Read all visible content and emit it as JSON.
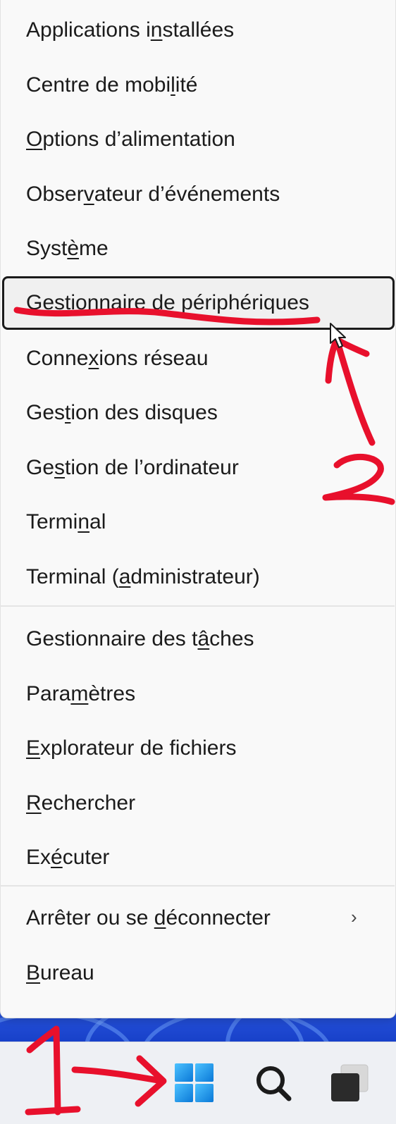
{
  "menu": {
    "group1": [
      {
        "before": "Applications i",
        "u": "n",
        "after": "stallées"
      },
      {
        "before": "Centre de mobi",
        "u": "l",
        "after": "ité"
      },
      {
        "before": "",
        "u": "O",
        "after": "ptions d’alimentation"
      },
      {
        "before": "Obser",
        "u": "v",
        "after": "ateur d’événements"
      },
      {
        "before": "Syst",
        "u": "è",
        "after": "me"
      },
      {
        "before": "",
        "u": "G",
        "after": "estionnaire de périphériques"
      },
      {
        "before": "Conne",
        "u": "x",
        "after": "ions réseau"
      },
      {
        "before": "Ges",
        "u": "t",
        "after": "ion des disques"
      },
      {
        "before": "Ge",
        "u": "s",
        "after": "tion de l’ordinateur"
      },
      {
        "before": "Termi",
        "u": "n",
        "after": "al"
      },
      {
        "before": "Terminal (",
        "u": "a",
        "after": "dministrateur)"
      }
    ],
    "group2": [
      {
        "before": "Gestionnaire des t",
        "u": "â",
        "after": "ches"
      },
      {
        "before": "Para",
        "u": "m",
        "after": "ètres"
      },
      {
        "before": "",
        "u": "E",
        "after": "xplorateur de fichiers"
      },
      {
        "before": "",
        "u": "R",
        "after": "echercher"
      },
      {
        "before": "Ex",
        "u": "é",
        "after": "cuter"
      }
    ],
    "group3": [
      {
        "before": "Arrêter ou se ",
        "u": "d",
        "after": "éconnecter",
        "submenu": true
      },
      {
        "before": "",
        "u": "B",
        "after": "ureau"
      }
    ],
    "chevron": "›"
  },
  "taskbar": {
    "icons": [
      "windows-start-icon",
      "search-icon",
      "task-view-icon"
    ]
  },
  "annotations": {
    "number_1": "1",
    "number_2": "2",
    "color": "#e8102c"
  }
}
